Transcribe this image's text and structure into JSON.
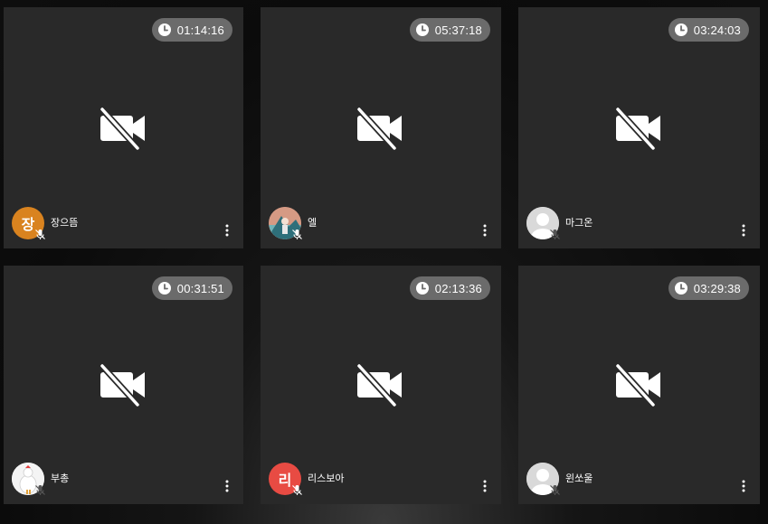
{
  "tiles": [
    {
      "timer": "01:14:16",
      "name": "장으뜸",
      "avatar": {
        "type": "initial",
        "text": "장",
        "color": "#d9831f"
      }
    },
    {
      "timer": "05:37:18",
      "name": "엘",
      "avatar": {
        "type": "photo",
        "color": "#c98f7e"
      }
    },
    {
      "timer": "03:24:03",
      "name": "마그온",
      "avatar": {
        "type": "default",
        "color": "#bfbfbf"
      }
    },
    {
      "timer": "00:31:51",
      "name": "부총",
      "avatar": {
        "type": "photo",
        "color": "#f2f2f2"
      }
    },
    {
      "timer": "02:13:36",
      "name": "리스보아",
      "avatar": {
        "type": "initial",
        "text": "리",
        "color": "#e84b43"
      }
    },
    {
      "timer": "03:29:38",
      "name": "윈쏘울",
      "avatar": {
        "type": "default",
        "color": "#bfbfbf"
      }
    }
  ],
  "icons": {
    "timer": "clock-icon",
    "video": "video-off-icon",
    "mic": "mic-off-icon",
    "menu": "more-vertical-icon"
  },
  "colors": {
    "tile_bg": "#292929",
    "timer_bg": "#6b6b6b",
    "page_bg": "#0e0e0e"
  }
}
